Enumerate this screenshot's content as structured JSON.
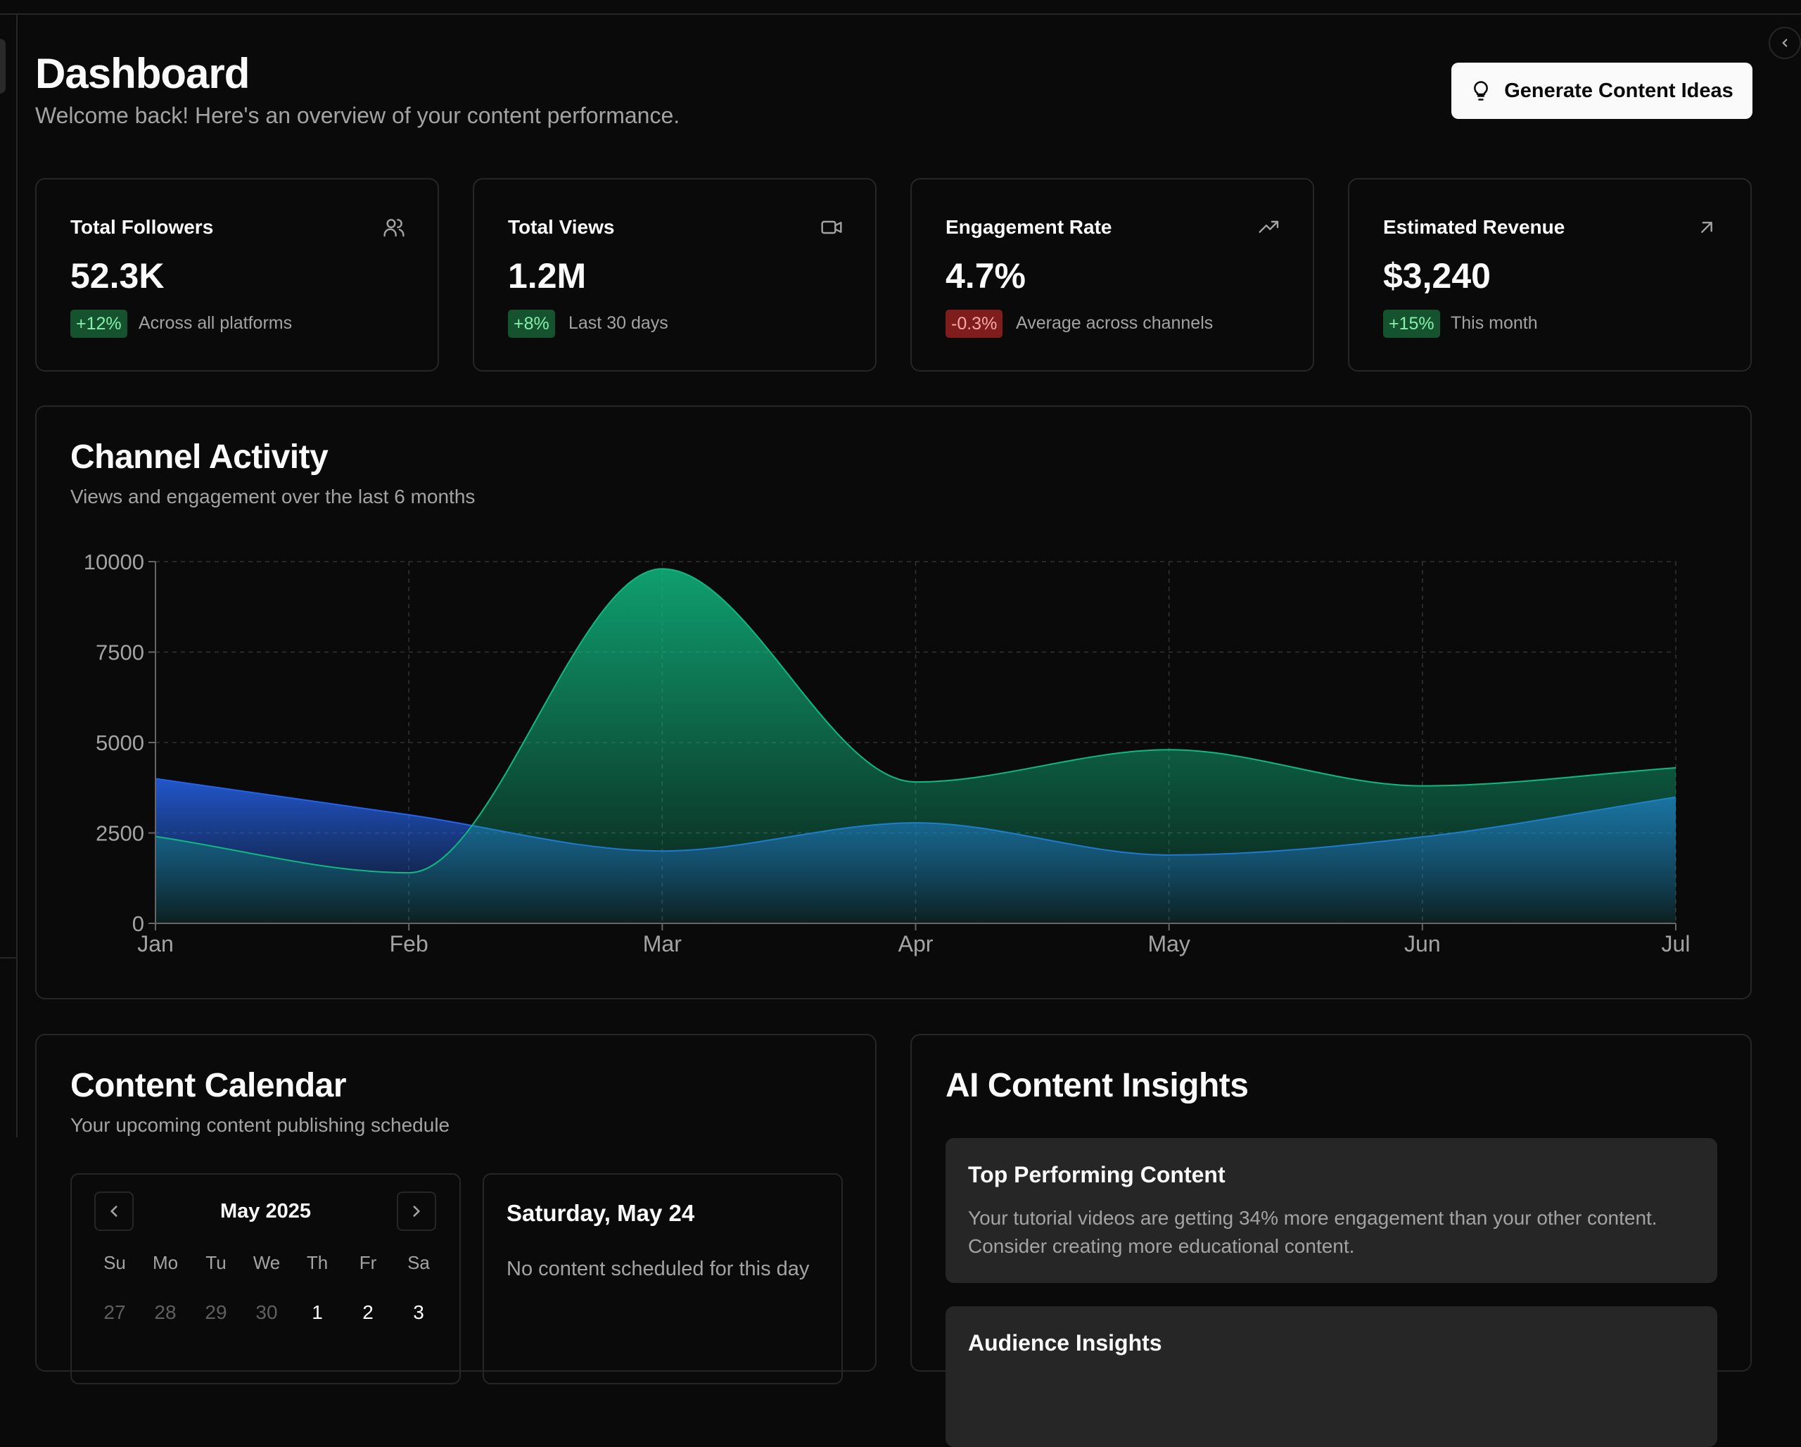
{
  "header": {
    "title": "Dashboard",
    "subtitle": "Welcome back! Here's an overview of your content performance.",
    "generate_button": "Generate Content Ideas",
    "generate_icon": "lightbulb-icon"
  },
  "stats": [
    {
      "label": "Total Followers",
      "icon": "users-icon",
      "value": "52.3K",
      "badge": "+12%",
      "badge_color": "#86efac",
      "caption": "Across all platforms"
    },
    {
      "label": "Total Views",
      "icon": "video-icon",
      "value": "1.2M",
      "badge": "+8%",
      "badge_color": "#86efac",
      "caption": "Last 30 days"
    },
    {
      "label": "Engagement Rate",
      "icon": "trending-up-icon",
      "value": "4.7%",
      "badge": "-0.3%",
      "badge_color": "#fca5a5",
      "caption": "Average across channels"
    },
    {
      "label": "Estimated Revenue",
      "icon": "arrow-up-right-icon",
      "value": "$3,240",
      "badge": "+15%",
      "badge_color": "#86efac",
      "caption": "This month"
    }
  ],
  "channel_activity": {
    "title": "Channel Activity",
    "subtitle": "Views and engagement over the last 6 months"
  },
  "chart_data": {
    "type": "area",
    "categories": [
      "Jan",
      "Feb",
      "Mar",
      "Apr",
      "May",
      "Jun",
      "Jul"
    ],
    "yticks": [
      "10000",
      "7500",
      "5000",
      "2500",
      "0"
    ],
    "ylim": [
      0,
      10000
    ],
    "grid": true,
    "series": [
      {
        "values": [
          4000,
          3000,
          2000,
          2780,
          1890,
          2390,
          3490
        ],
        "color": "#2563eb"
      },
      {
        "values": [
          2400,
          1398,
          9800,
          3908,
          4800,
          3800,
          4300
        ],
        "color": "#10b981"
      }
    ]
  },
  "calendar": {
    "title": "Content Calendar",
    "subtitle": "Your upcoming content publishing schedule",
    "month": "May 2025",
    "prev_icon": "chevron-left-icon",
    "next_icon": "chevron-right-icon",
    "weekdays": [
      "Su",
      "Mo",
      "Tu",
      "We",
      "Th",
      "Fr",
      "Sa"
    ],
    "days": [
      "27",
      "28",
      "29",
      "30",
      "1",
      "2",
      "3"
    ],
    "selected_day_title": "Saturday, May 24",
    "selected_day_text": "No content scheduled for this day"
  },
  "insights": {
    "title": "AI Content Insights",
    "cards": [
      {
        "title": "Top Performing Content",
        "text": "Your tutorial videos are getting 34% more engagement than your other content. Consider creating more educational content."
      },
      {
        "title": "Audience Insights",
        "text": ""
      }
    ]
  }
}
